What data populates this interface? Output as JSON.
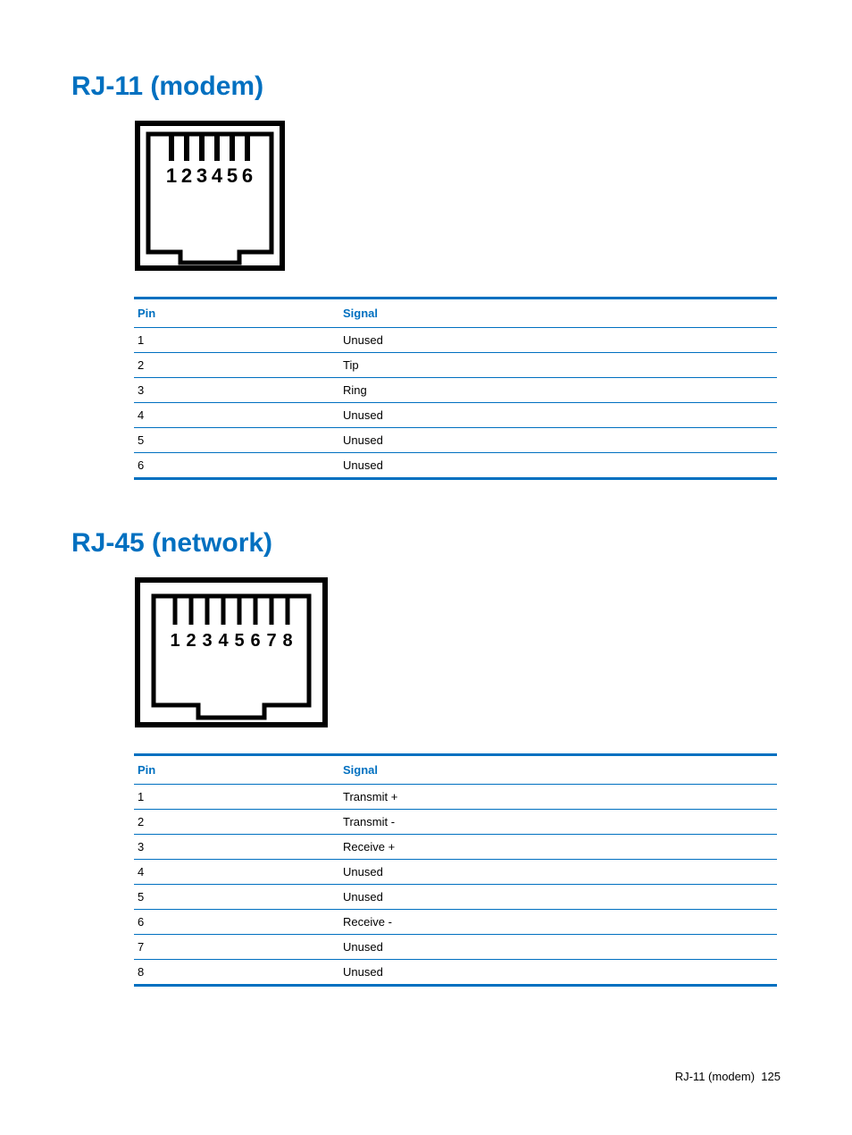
{
  "sections": [
    {
      "heading": "RJ-11 (modem)",
      "pins": [
        1,
        2,
        3,
        4,
        5,
        6
      ],
      "table_headers": {
        "pin": "Pin",
        "signal": "Signal"
      },
      "rows": [
        {
          "pin": "1",
          "signal": "Unused"
        },
        {
          "pin": "2",
          "signal": "Tip"
        },
        {
          "pin": "3",
          "signal": "Ring"
        },
        {
          "pin": "4",
          "signal": "Unused"
        },
        {
          "pin": "5",
          "signal": "Unused"
        },
        {
          "pin": "6",
          "signal": "Unused"
        }
      ]
    },
    {
      "heading": "RJ-45 (network)",
      "pins": [
        1,
        2,
        3,
        4,
        5,
        6,
        7,
        8
      ],
      "table_headers": {
        "pin": "Pin",
        "signal": "Signal"
      },
      "rows": [
        {
          "pin": "1",
          "signal": "Transmit +"
        },
        {
          "pin": "2",
          "signal": "Transmit -"
        },
        {
          "pin": "3",
          "signal": "Receive +"
        },
        {
          "pin": "4",
          "signal": "Unused"
        },
        {
          "pin": "5",
          "signal": "Unused"
        },
        {
          "pin": "6",
          "signal": "Receive -"
        },
        {
          "pin": "7",
          "signal": "Unused"
        },
        {
          "pin": "8",
          "signal": "Unused"
        }
      ]
    }
  ],
  "footer": {
    "text": "RJ-11 (modem)",
    "page": "125"
  }
}
